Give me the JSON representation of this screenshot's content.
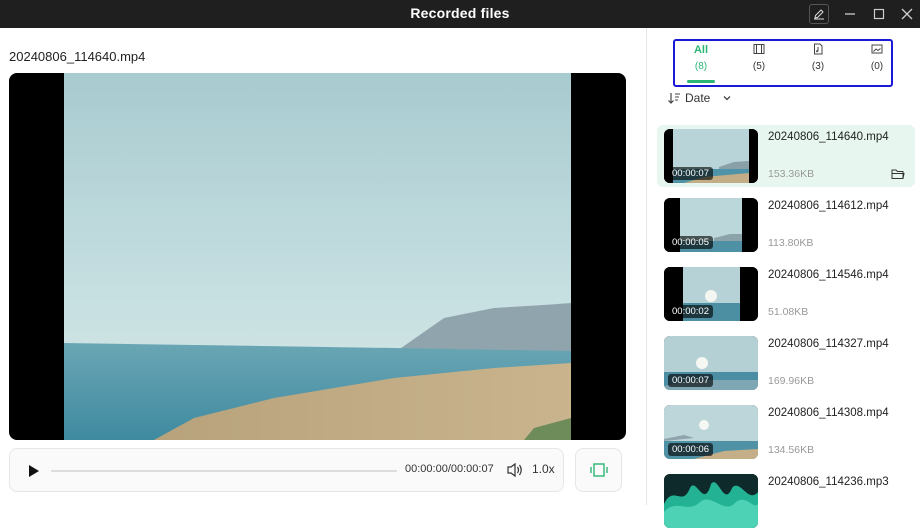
{
  "window": {
    "title": "Recorded files"
  },
  "player": {
    "filename": "20240806_114640.mp4",
    "time": "00:00:00/00:00:07",
    "speed": "1.0x",
    "progress": 0
  },
  "tabs": [
    {
      "label": "All",
      "count": "(8)",
      "icon": "all",
      "active": true
    },
    {
      "label": "",
      "count": "(5)",
      "icon": "video-icon",
      "active": false
    },
    {
      "label": "",
      "count": "(3)",
      "icon": "audio-file-icon",
      "active": false
    },
    {
      "label": "",
      "count": "(0)",
      "icon": "image-icon",
      "active": false
    }
  ],
  "sort": {
    "label": "Date"
  },
  "files": [
    {
      "name": "20240806_114640.mp4",
      "size": "153.36KB",
      "duration": "00:00:07",
      "selected": true
    },
    {
      "name": "20240806_114612.mp4",
      "size": "113.80KB",
      "duration": "00:00:05",
      "selected": false
    },
    {
      "name": "20240806_114546.mp4",
      "size": "51.08KB",
      "duration": "00:00:02",
      "selected": false
    },
    {
      "name": "20240806_114327.mp4",
      "size": "169.96KB",
      "duration": "00:00:07",
      "selected": false
    },
    {
      "name": "20240806_114308.mp4",
      "size": "134.56KB",
      "duration": "00:00:06",
      "selected": false
    },
    {
      "name": "20240806_114236.mp3",
      "size": "",
      "duration": "",
      "selected": false
    }
  ],
  "colors": {
    "accent": "#2bb673",
    "titlebar": "#1f1f1f",
    "highlight_box": "#1a1ad6"
  }
}
